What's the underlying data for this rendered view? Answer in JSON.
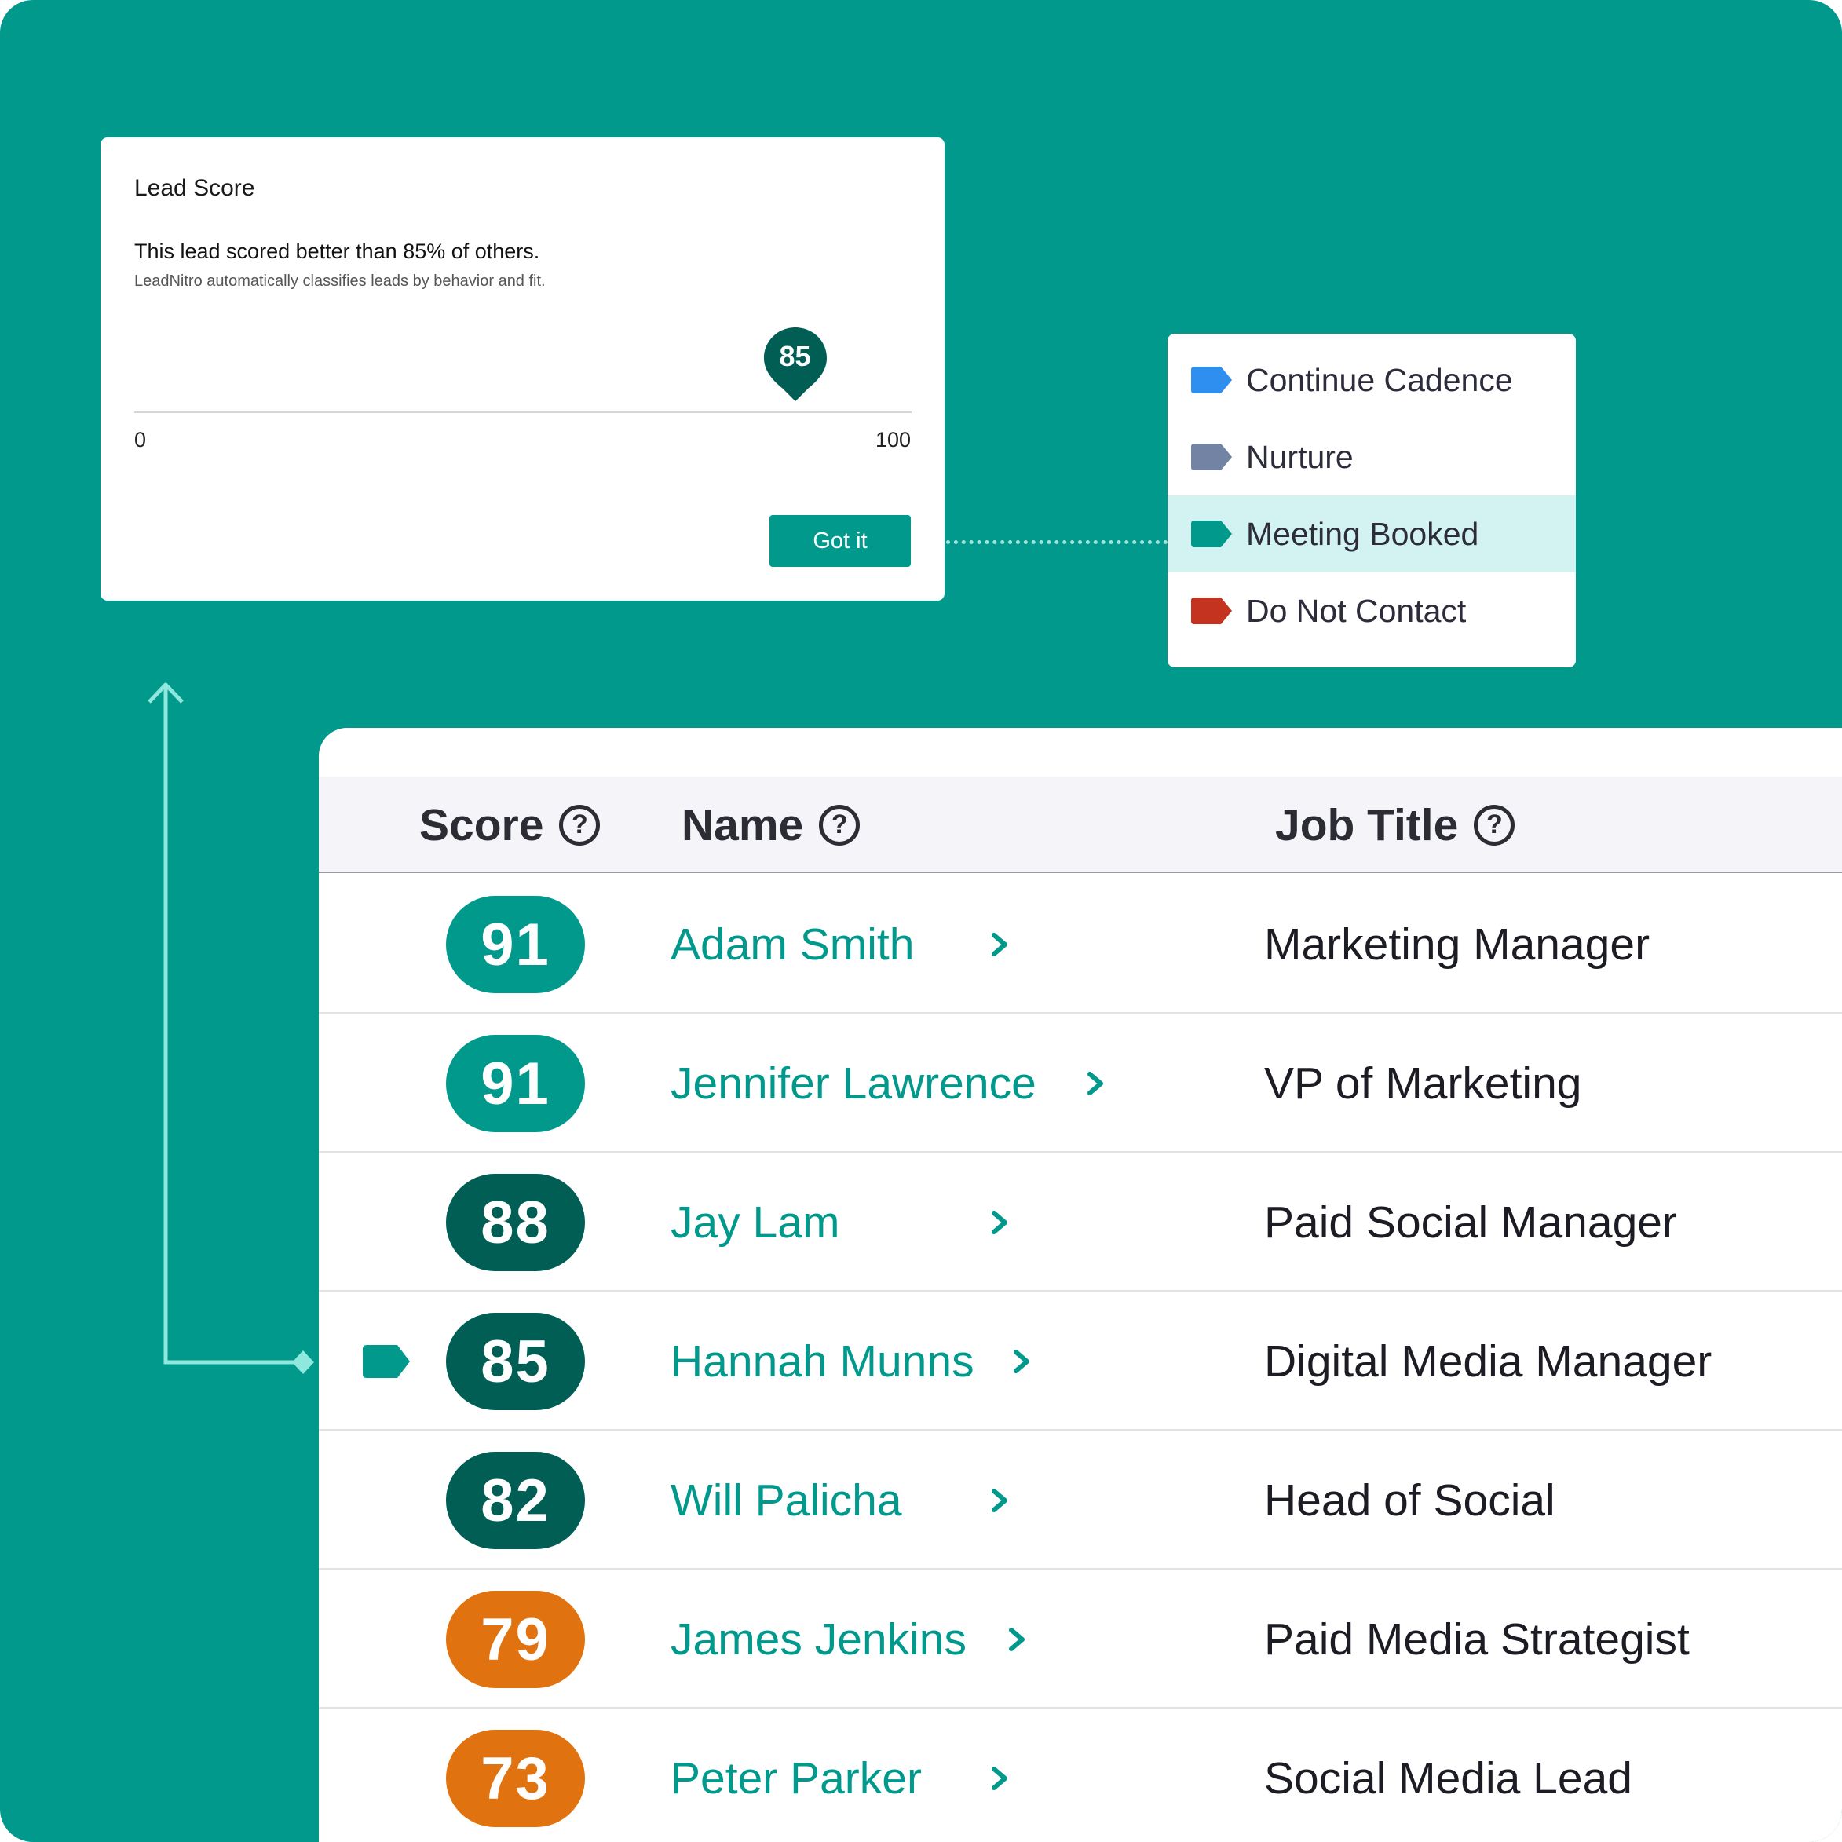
{
  "colors": {
    "brand": "#00998c",
    "dark_teal": "#005e54",
    "orange": "#e0720f",
    "blue_tag": "#2f8ff0",
    "gray_tag": "#7383a4",
    "teal_tag": "#00998c",
    "red_tag": "#c4331f"
  },
  "score_card": {
    "title": "Lead Score",
    "headline": "This lead scored better than 85% of others.",
    "subtext": "LeadNitro automatically classifies leads by behavior and fit.",
    "score": "85",
    "score_fraction": 0.85,
    "min_label": "0",
    "max_label": "100",
    "button_label": "Got it"
  },
  "status_menu": {
    "items": [
      {
        "label": "Continue Cadence",
        "color": "#2f8ff0",
        "selected": false
      },
      {
        "label": "Nurture",
        "color": "#7383a4",
        "selected": false
      },
      {
        "label": "Meeting Booked",
        "color": "#00998c",
        "selected": true
      },
      {
        "label": "Do Not Contact",
        "color": "#c4331f",
        "selected": false
      }
    ]
  },
  "table": {
    "columns": {
      "score": "Score",
      "name": "Name",
      "job_title": "Job Title",
      "help_glyph": "?"
    },
    "rows": [
      {
        "score": "91",
        "name": "Adam Smith",
        "job": "Marketing Manager",
        "color": "#00998c"
      },
      {
        "score": "91",
        "name": "Jennifer Lawrence",
        "job": "VP of Marketing",
        "color": "#00998c"
      },
      {
        "score": "88",
        "name": "Jay Lam",
        "job": "Paid Social Manager",
        "color": "#005e54"
      },
      {
        "score": "85",
        "name": "Hannah Munns",
        "job": "Digital Media Manager",
        "color": "#005e54",
        "tag_color": "#00998c"
      },
      {
        "score": "82",
        "name": "Will Palicha",
        "job": "Head of Social",
        "color": "#005e54"
      },
      {
        "score": "79",
        "name": "James Jenkins",
        "job": "Paid Media Strategist",
        "color": "#e0720f"
      },
      {
        "score": "73",
        "name": "Peter Parker",
        "job": "Social Media Lead",
        "color": "#e0720f"
      }
    ]
  }
}
